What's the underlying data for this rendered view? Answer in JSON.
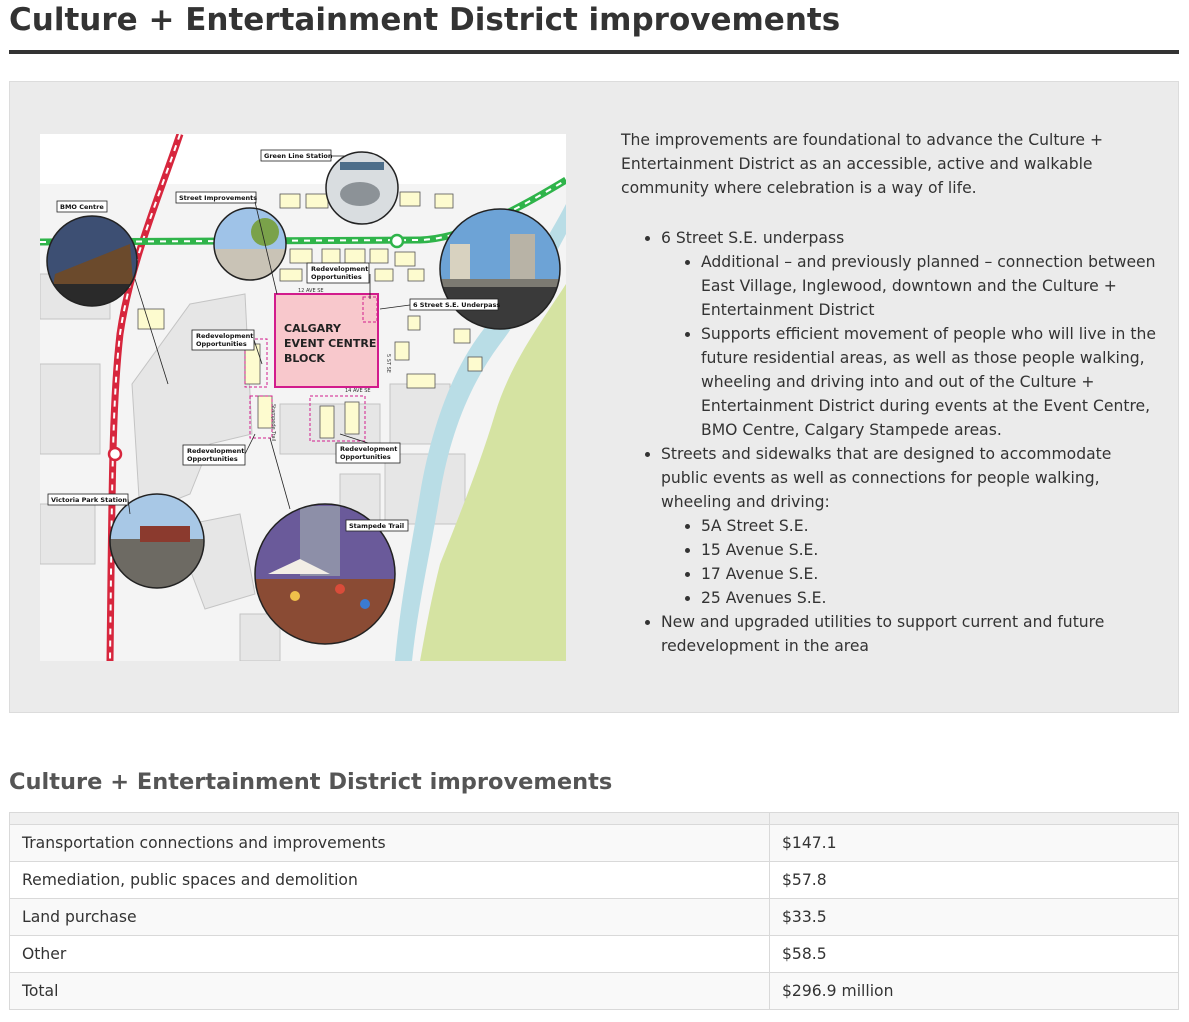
{
  "page": {
    "title": "Culture + Entertainment District improvements"
  },
  "map": {
    "labels": {
      "green_line_station": "Green Line Station",
      "street_improvements": "Street Improvements",
      "bmo_centre": "BMO Centre",
      "redev_line1": "Redevelopment",
      "redev_line2": "Opportunities",
      "twelve_ave": "12 AVE SE",
      "fourteen_ave": "14 AVE SE",
      "fifth_st": "5 ST SE",
      "underpass": "6 Street S.E. Underpass",
      "block_line1": "CALGARY",
      "block_line2": "EVENT CENTRE",
      "block_line3": "BLOCK",
      "victoria_park": "Victoria Park Station",
      "stampede_trail": "Stampede Trail",
      "stampede_trail_street": "Stampede Trail"
    },
    "colors": {
      "lrt_red": "#d7263d",
      "lrt_green": "#2fb44a",
      "block_outline": "#d21c8c",
      "block_fill": "#f8c8cc",
      "river": "#b9dde6",
      "park": "#d5e3a2"
    }
  },
  "content": {
    "intro": "The improvements are foundational to advance the Culture + Entertainment District as an accessible, active and walkable community where celebration is a way of life.",
    "items": [
      {
        "text": "6 Street S.E. underpass",
        "sub": [
          "Additional – and previously planned – connection between East Village, Inglewood, downtown and the Culture + Entertainment District",
          "Supports efficient movement of people who will live in the future residential areas, as well as those people walking, wheeling and driving into and out of the Culture + Entertainment District during events at the Event Centre, BMO Centre, Calgary Stampede areas."
        ]
      },
      {
        "text": "Streets and sidewalks that are designed to accommodate public events as well as connections for people walking, wheeling and driving:",
        "sub": [
          "5A Street S.E.",
          "15 Avenue S.E.",
          "17 Avenue S.E.",
          "25 Avenues S.E."
        ]
      },
      {
        "text": "New and upgraded utilities to support current and future redevelopment in the area"
      }
    ]
  },
  "table": {
    "title": "Culture + Entertainment District improvements",
    "rows": [
      [
        "Transportation connections and improvements",
        "$147.1"
      ],
      [
        "Remediation, public spaces and demolition",
        "$57.8"
      ],
      [
        "Land purchase",
        "$33.5"
      ],
      [
        "Other",
        "$58.5"
      ],
      [
        "Total",
        "$296.9 million"
      ]
    ]
  }
}
